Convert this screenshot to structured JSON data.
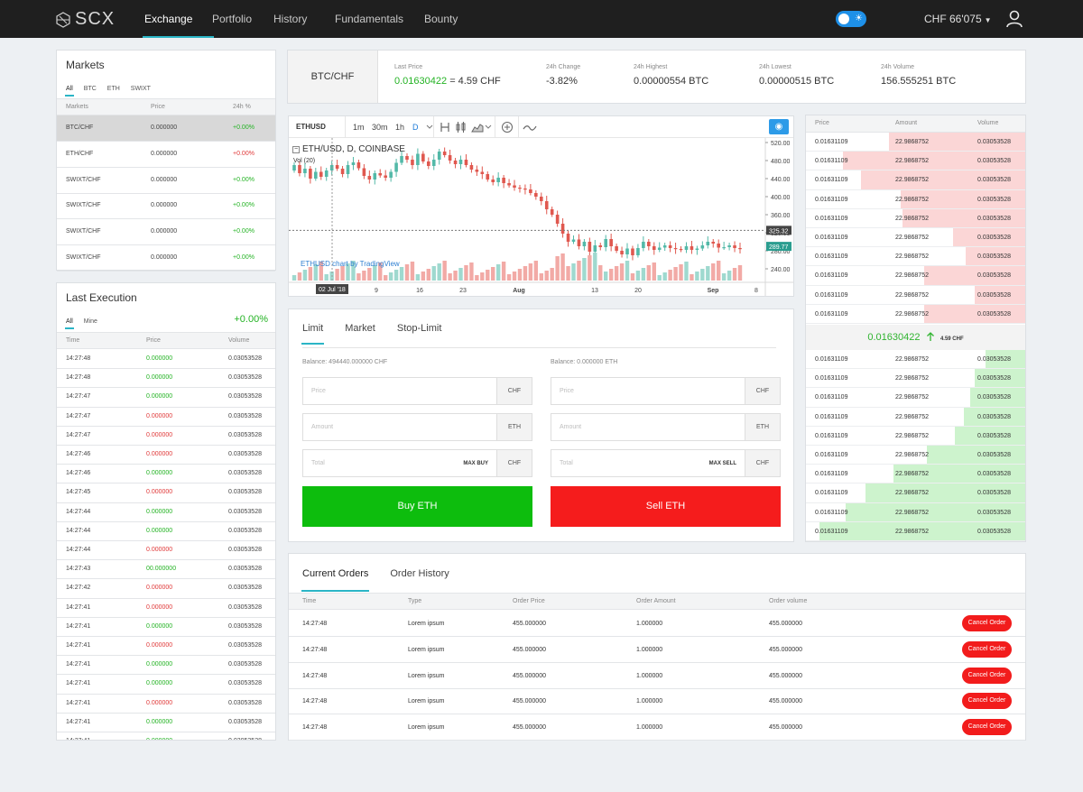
{
  "nav": {
    "logo": "SCX",
    "items": [
      "Exchange",
      "Portfolio",
      "History",
      "Fundamentals",
      "Bounty"
    ],
    "active": "Exchange",
    "balance": "CHF 66'075",
    "theme_toggle_icon": "sun-icon",
    "user_icon": "user-icon"
  },
  "markets": {
    "title": "Markets",
    "filters": [
      "All",
      "BTC",
      "ETH",
      "SWIXT"
    ],
    "headers": [
      "Markets",
      "Price",
      "24h %"
    ],
    "rows": [
      {
        "pair": "BTC/CHF",
        "price": "0.000000",
        "change": "+0.00%",
        "dir": "up"
      },
      {
        "pair": "ETH/CHF",
        "price": "0.000000",
        "change": "+0.00%",
        "dir": "down"
      },
      {
        "pair": "SWIXT/CHF",
        "price": "0.000000",
        "change": "+0.00%",
        "dir": "up"
      },
      {
        "pair": "SWIXT/CHF",
        "price": "0.000000",
        "change": "+0.00%",
        "dir": "up"
      },
      {
        "pair": "SWIXT/CHF",
        "price": "0.000000",
        "change": "+0.00%",
        "dir": "up"
      },
      {
        "pair": "SWIXT/CHF",
        "price": "0.000000",
        "change": "+0.00%",
        "dir": "up"
      }
    ]
  },
  "execution": {
    "title": "Last Execution",
    "filters": [
      "All",
      "Mine"
    ],
    "change": "+0.00%",
    "headers": [
      "Time",
      "Price",
      "Volume"
    ],
    "rows": [
      {
        "time": "14:27:48",
        "price": "0.000000",
        "volume": "0.03053528",
        "dir": "up"
      },
      {
        "time": "14:27:48",
        "price": "0.000000",
        "volume": "0.03053528",
        "dir": "up"
      },
      {
        "time": "14:27:47",
        "price": "0.000000",
        "volume": "0.03053528",
        "dir": "up"
      },
      {
        "time": "14:27:47",
        "price": "0.000000",
        "volume": "0.03053528",
        "dir": "down"
      },
      {
        "time": "14:27:47",
        "price": "0.000000",
        "volume": "0.03053528",
        "dir": "down"
      },
      {
        "time": "14:27:46",
        "price": "0.000000",
        "volume": "0.03053528",
        "dir": "down"
      },
      {
        "time": "14:27:46",
        "price": "0.000000",
        "volume": "0.03053528",
        "dir": "up"
      },
      {
        "time": "14:27:45",
        "price": "0.000000",
        "volume": "0.03053528",
        "dir": "down"
      },
      {
        "time": "14:27:44",
        "price": "0.000000",
        "volume": "0.03053528",
        "dir": "up"
      },
      {
        "time": "14:27:44",
        "price": "0.000000",
        "volume": "0.03053528",
        "dir": "up"
      },
      {
        "time": "14:27:44",
        "price": "0.000000",
        "volume": "0.03053528",
        "dir": "down"
      },
      {
        "time": "14:27:43",
        "price": "00.000000",
        "volume": "0.03053528",
        "dir": "up"
      },
      {
        "time": "14:27:42",
        "price": "0.000000",
        "volume": "0.03053528",
        "dir": "down"
      },
      {
        "time": "14:27:41",
        "price": "0.000000",
        "volume": "0.03053528",
        "dir": "down"
      },
      {
        "time": "14:27:41",
        "price": "0.000000",
        "volume": "0.03053528",
        "dir": "up"
      },
      {
        "time": "14:27:41",
        "price": "0.000000",
        "volume": "0.03053528",
        "dir": "down"
      },
      {
        "time": "14:27:41",
        "price": "0.000000",
        "volume": "0.03053528",
        "dir": "up"
      },
      {
        "time": "14:27:41",
        "price": "0.000000",
        "volume": "0.03053528",
        "dir": "up"
      },
      {
        "time": "14:27:41",
        "price": "0.000000",
        "volume": "0.03053528",
        "dir": "down"
      },
      {
        "time": "14:27:41",
        "price": "0.000000",
        "volume": "0.03053528",
        "dir": "up"
      },
      {
        "time": "14:27:41",
        "price": "0.000000",
        "volume": "0.03053528",
        "dir": "up"
      }
    ]
  },
  "ticker": {
    "pair": "BTC/CHF",
    "last_price_label": "Last Price",
    "last_price": "0.01630422",
    "last_price_fiat": "= 4.59 CHF",
    "change_label": "24h Change",
    "change": "-3.82%",
    "high_label": "24h Highest",
    "high": "0.00000554 BTC",
    "low_label": "24h Lowest",
    "low": "0.00000515 BTC",
    "volume_label": "24h Volume",
    "volume": "156.555251 BTC"
  },
  "chart": {
    "symbol": "ETHUSD",
    "timeframes": [
      "1m",
      "30m",
      "1h",
      "D"
    ],
    "active_timeframe": "D",
    "toolbar_icons": [
      "compare-icon",
      "candles-icon",
      "area-icon",
      "indicators-icon",
      "add-icon",
      "line-icon"
    ],
    "title": "ETH/USD, D, COINBASE",
    "vol_label": "Vol (20)",
    "watermark": "ETHUSD chart by TradingView",
    "price_ticks": [
      "520.00",
      "480.00",
      "440.00",
      "400.00",
      "360.00",
      "320.00",
      "280.00",
      "240.00"
    ],
    "date_labels": [
      "02 Jul '18",
      "9",
      "16",
      "23",
      "Aug",
      "13",
      "20",
      "Sep",
      "8"
    ],
    "price_marker_1": "325.32",
    "price_marker_2": "289.77",
    "chart_data": {
      "type": "candlestick",
      "ylim": [
        230,
        530
      ],
      "marker_dark": 325.32,
      "marker_green": 289.77
    }
  },
  "order_form": {
    "tabs": [
      "Limit",
      "Market",
      "Stop-Limit"
    ],
    "active_tab": "Limit",
    "buy": {
      "balance": "Balance: 494440.000000 CHF",
      "price_placeholder": "Price",
      "price_unit": "CHF",
      "amount_placeholder": "Amount",
      "amount_unit": "ETH",
      "total_placeholder": "Total",
      "total_max": "MAX BUY",
      "total_unit": "CHF",
      "button": "Buy ETH"
    },
    "sell": {
      "balance": "Balance: 0.000000 ETH",
      "price_placeholder": "Price",
      "price_unit": "CHF",
      "amount_placeholder": "Amount",
      "amount_unit": "ETH",
      "total_placeholder": "Total",
      "total_max": "MAX SELL",
      "total_unit": "CHF",
      "button": "Sell ETH"
    }
  },
  "orderbook": {
    "headers": [
      "Price",
      "Amount",
      "Volume"
    ],
    "asks": [
      {
        "price": "0.01631109",
        "amount": "22.9868752",
        "volume": "0.03053528",
        "fill": 0.62
      },
      {
        "price": "0.01631109",
        "amount": "22.9868752",
        "volume": "0.03053528",
        "fill": 0.83
      },
      {
        "price": "0.01631109",
        "amount": "22.9868752",
        "volume": "0.03053528",
        "fill": 0.75
      },
      {
        "price": "0.01631109",
        "amount": "22.9868752",
        "volume": "0.03053528",
        "fill": 0.57
      },
      {
        "price": "0.01631109",
        "amount": "22.9868752",
        "volume": "0.03053528",
        "fill": 0.56
      },
      {
        "price": "0.01631109",
        "amount": "22.9868752",
        "volume": "0.03053528",
        "fill": 0.33
      },
      {
        "price": "0.01631109",
        "amount": "22.9868752",
        "volume": "0.03053528",
        "fill": 0.27
      },
      {
        "price": "0.01631109",
        "amount": "22.9868752",
        "volume": "0.03053528",
        "fill": 0.46
      },
      {
        "price": "0.01631109",
        "amount": "22.9868752",
        "volume": "0.03053528",
        "fill": 0.23
      },
      {
        "price": "0.01631109",
        "amount": "22.9868752",
        "volume": "0.03053528",
        "fill": 0.46
      }
    ],
    "mid_price": "0.01630422",
    "mid_fiat": "4.59 CHF",
    "mid_icon": "arrow-up-icon",
    "bids": [
      {
        "price": "0.01631109",
        "amount": "22.9868752",
        "volume": "0.03053528",
        "fill": 0.18
      },
      {
        "price": "0.01631109",
        "amount": "22.9868752",
        "volume": "0.03053528",
        "fill": 0.23
      },
      {
        "price": "0.01631109",
        "amount": "22.9868752",
        "volume": "0.03053528",
        "fill": 0.25
      },
      {
        "price": "0.01631109",
        "amount": "22.9868752",
        "volume": "0.03053528",
        "fill": 0.28
      },
      {
        "price": "0.01631109",
        "amount": "22.9868752",
        "volume": "0.03053528",
        "fill": 0.32
      },
      {
        "price": "0.01631109",
        "amount": "22.9868752",
        "volume": "0.03053528",
        "fill": 0.45
      },
      {
        "price": "0.01631109",
        "amount": "22.9868752",
        "volume": "0.03053528",
        "fill": 0.6
      },
      {
        "price": "0.01631109",
        "amount": "22.9868752",
        "volume": "0.03053528",
        "fill": 0.73
      },
      {
        "price": "0.01631109",
        "amount": "22.9868752",
        "volume": "0.03053528",
        "fill": 0.82
      },
      {
        "price": "0.01631109",
        "amount": "22.9868752",
        "volume": "0.03053528",
        "fill": 0.94
      }
    ]
  },
  "orders": {
    "tabs": [
      "Current Orders",
      "Order History"
    ],
    "active_tab": "Current Orders",
    "headers": [
      "Time",
      "Type",
      "Order Price",
      "Order Amount",
      "Order volume"
    ],
    "rows": [
      {
        "time": "14:27:48",
        "type": "Lorem ipsum",
        "price": "455.000000",
        "amount": "1.000000",
        "volume": "455.000000",
        "action": "Cancel Order"
      },
      {
        "time": "14:27:48",
        "type": "Lorem ipsum",
        "price": "455.000000",
        "amount": "1.000000",
        "volume": "455.000000",
        "action": "Cancel Order"
      },
      {
        "time": "14:27:48",
        "type": "Lorem ipsum",
        "price": "455.000000",
        "amount": "1.000000",
        "volume": "455.000000",
        "action": "Cancel Order"
      },
      {
        "time": "14:27:48",
        "type": "Lorem ipsum",
        "price": "455.000000",
        "amount": "1.000000",
        "volume": "455.000000",
        "action": "Cancel Order"
      },
      {
        "time": "14:27:48",
        "type": "Lorem ipsum",
        "price": "455.000000",
        "amount": "1.000000",
        "volume": "455.000000",
        "action": "Cancel Order"
      }
    ]
  },
  "colors": {
    "accent": "#2bb5c6",
    "up": "#24b324",
    "down": "#e03a3a",
    "buy": "#0dbd0d",
    "sell": "#f51c1c",
    "nav_bg": "#1f1f1f"
  }
}
